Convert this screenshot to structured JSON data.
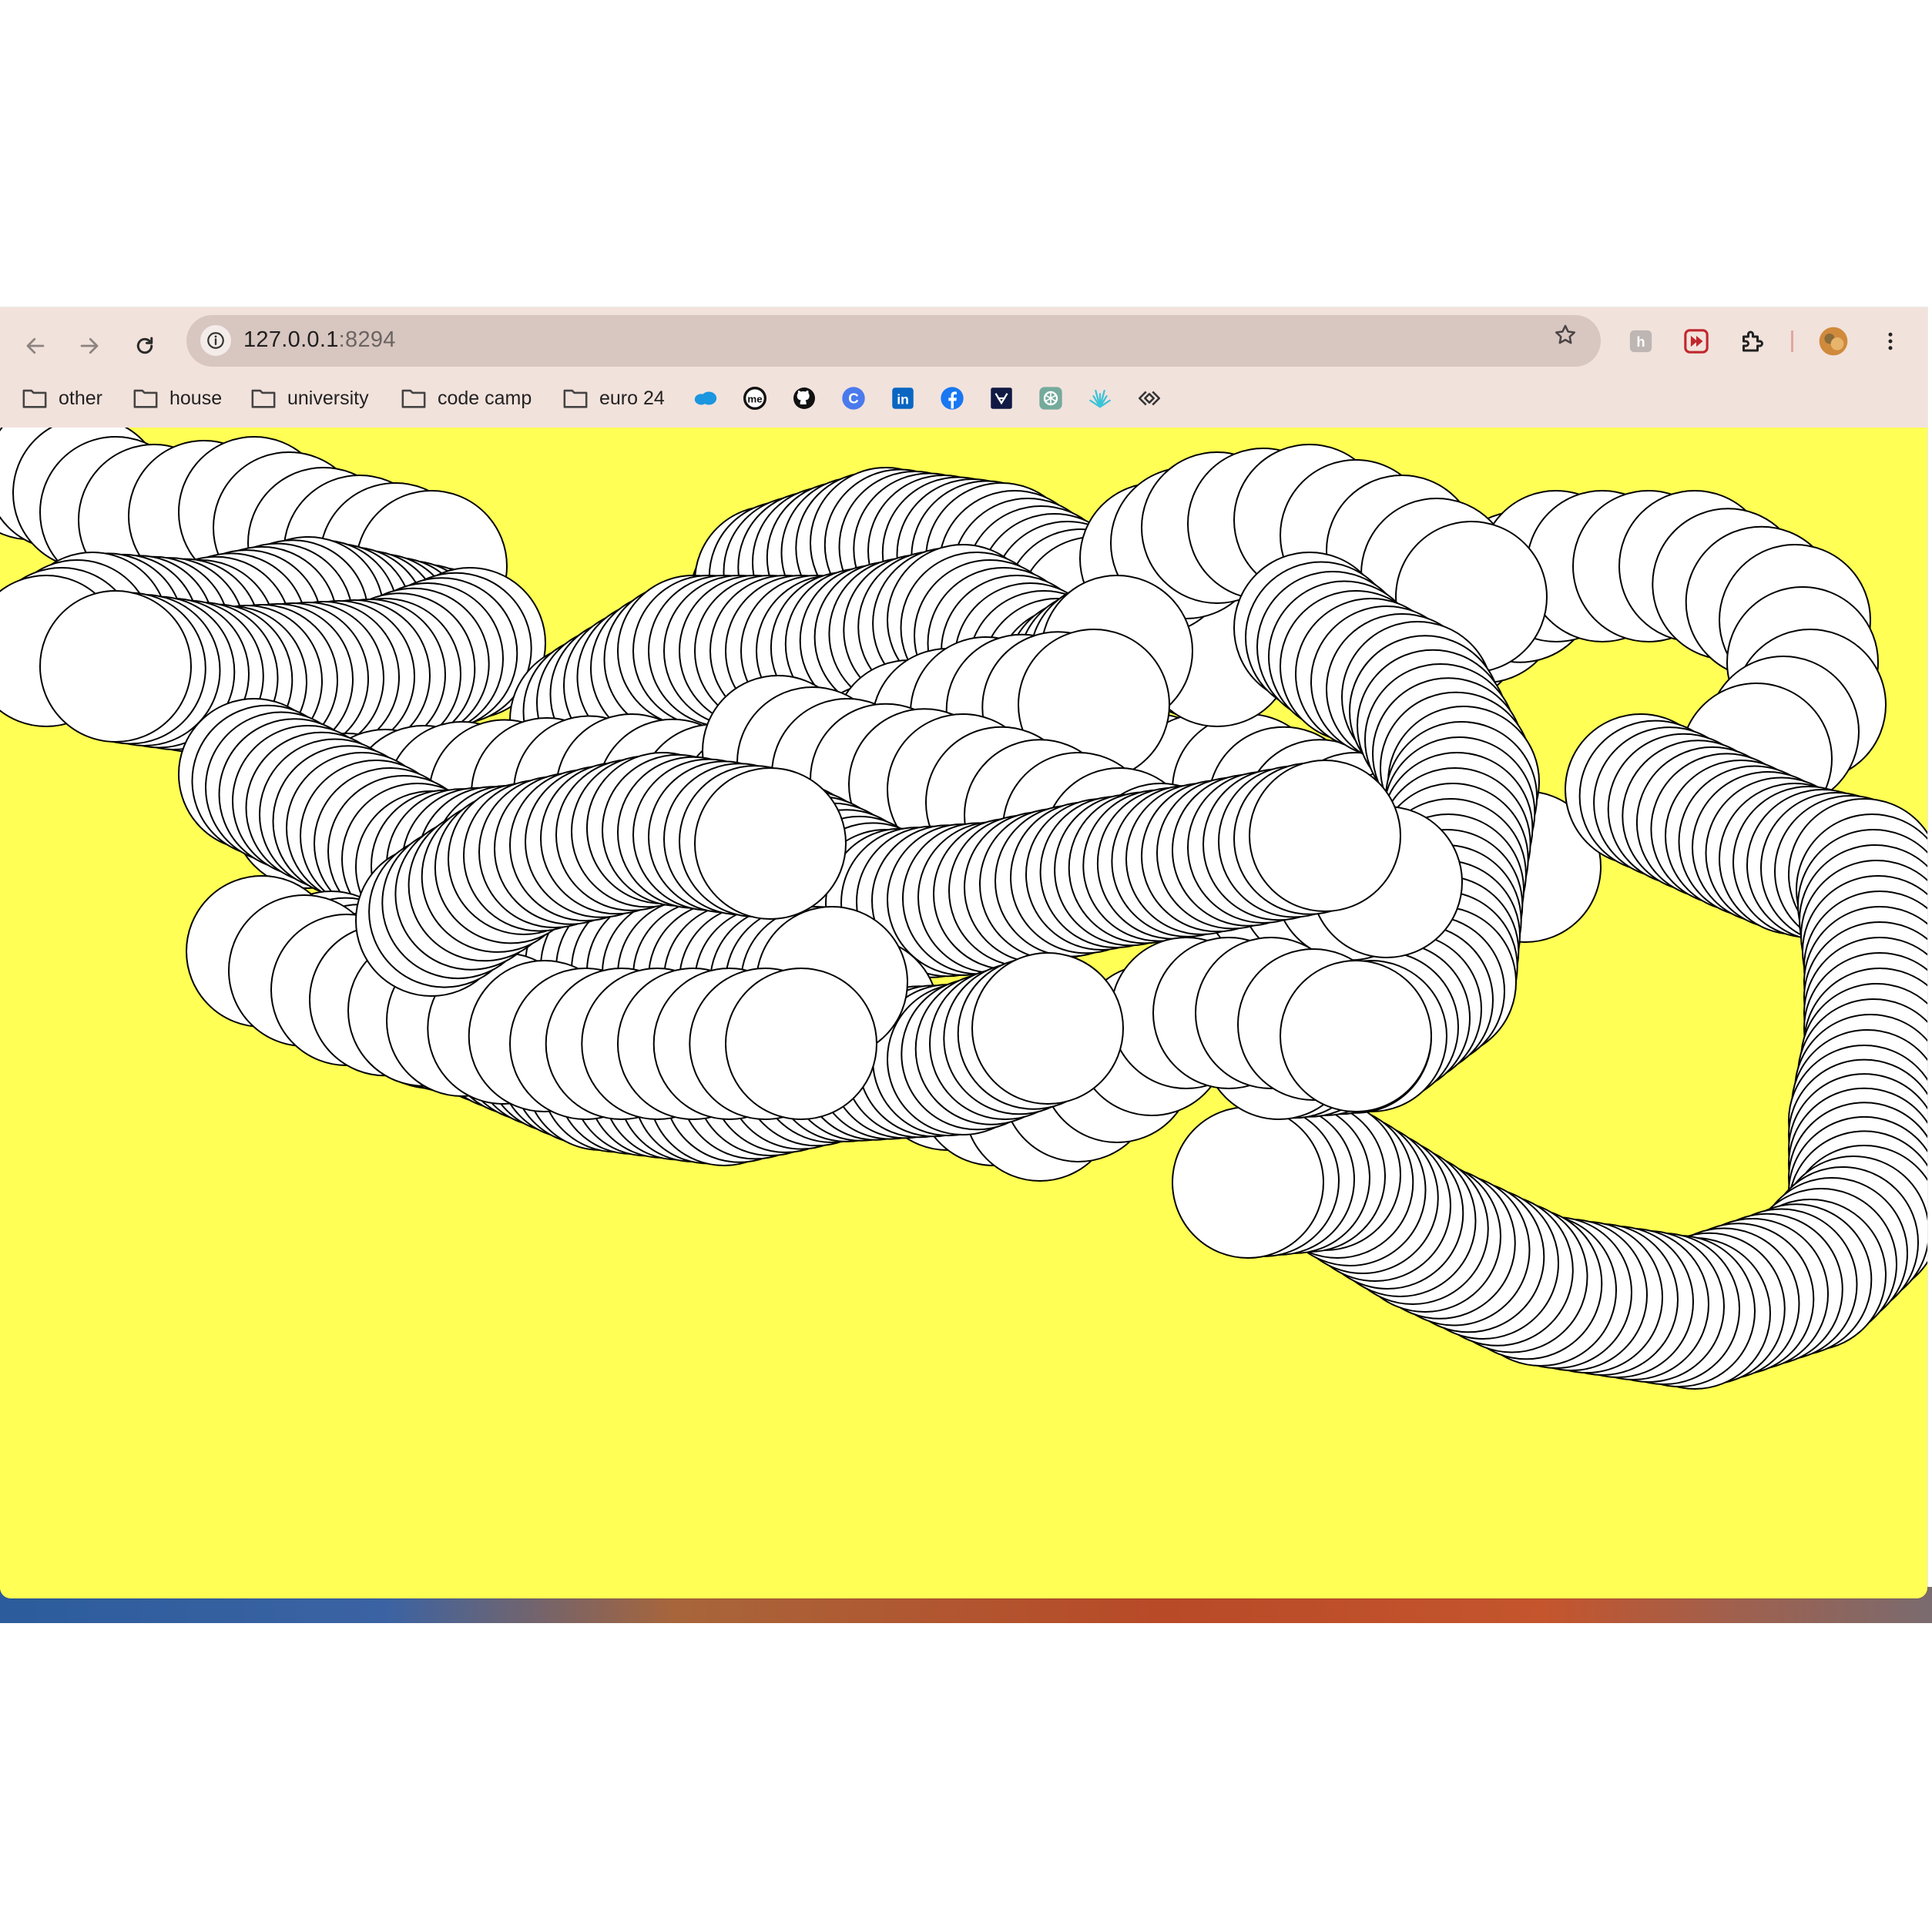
{
  "browser": {
    "url_host": "127.0.0.1",
    "url_port": ":8294",
    "nav": {
      "back_icon": "arrow-left-icon",
      "forward_icon": "arrow-right-icon",
      "reload_icon": "reload-icon"
    },
    "bookmarks": [
      {
        "label": "other",
        "type": "folder"
      },
      {
        "label": "house",
        "type": "folder"
      },
      {
        "label": "university",
        "type": "folder"
      },
      {
        "label": "code camp",
        "type": "folder"
      },
      {
        "label": "euro 24",
        "type": "folder"
      }
    ],
    "bookmark_icons": [
      "salesforce-icon",
      "medium-icon",
      "github-icon",
      "coursera-icon",
      "linkedin-icon",
      "facebook-icon",
      "jira-icon",
      "chatgpt-icon",
      "sparkle-icon",
      "link-icon"
    ],
    "extension_icons": [
      "extension-h-icon",
      "extension-red-icon",
      "puzzle-icon",
      "profile-avatar",
      "menu-kebab-icon"
    ]
  },
  "canvas": {
    "background_color": "#ffff55",
    "circle_fill": "#ffffff",
    "circle_stroke": "#000000"
  }
}
